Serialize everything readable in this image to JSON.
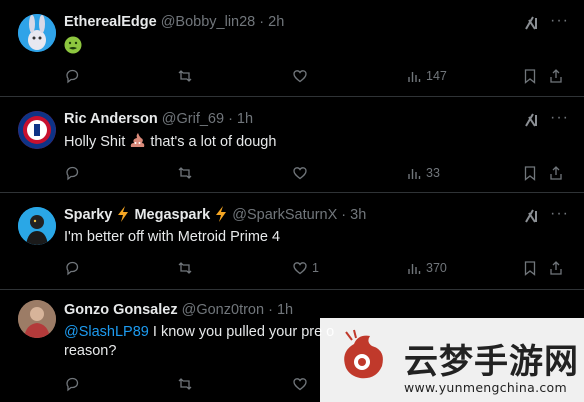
{
  "tweets": [
    {
      "name": "EtherealEdge",
      "handle": "@Bobby_lin28",
      "time": "· 2h",
      "text": "",
      "emoji": "nauseated-face",
      "views": "147",
      "likes": "",
      "replies": "",
      "reposts": ""
    },
    {
      "name": "Ric Anderson",
      "handle": "@Grif_69",
      "time": "· 1h",
      "text_before": "Holly Shit",
      "text_after": "that's a lot of dough",
      "emoji": "pile-of-poo",
      "views": "33",
      "likes": ""
    },
    {
      "name": "Sparky",
      "name_part2": "Megaspark",
      "handle": "@SparkSaturnX",
      "time": "· 3h",
      "text": "I'm better off with Metroid Prime 4",
      "emoji": "lightning",
      "views": "370",
      "likes": "1"
    },
    {
      "name": "Gonzo Gonsalez",
      "handle": "@Gonz0tron",
      "time": "· 1h",
      "mention": "@SlashLP89",
      "text": " I know you pulled your pre o",
      "text_line2": "reason?",
      "views": "",
      "likes": ""
    }
  ],
  "watermark": {
    "title": "云梦手游网",
    "url": "www.yunmengchina.com"
  },
  "colors": {
    "background": "#000000",
    "text": "#e7e9ea",
    "muted": "#71767b",
    "link": "#1d9bf0",
    "divider": "#2f3336"
  }
}
